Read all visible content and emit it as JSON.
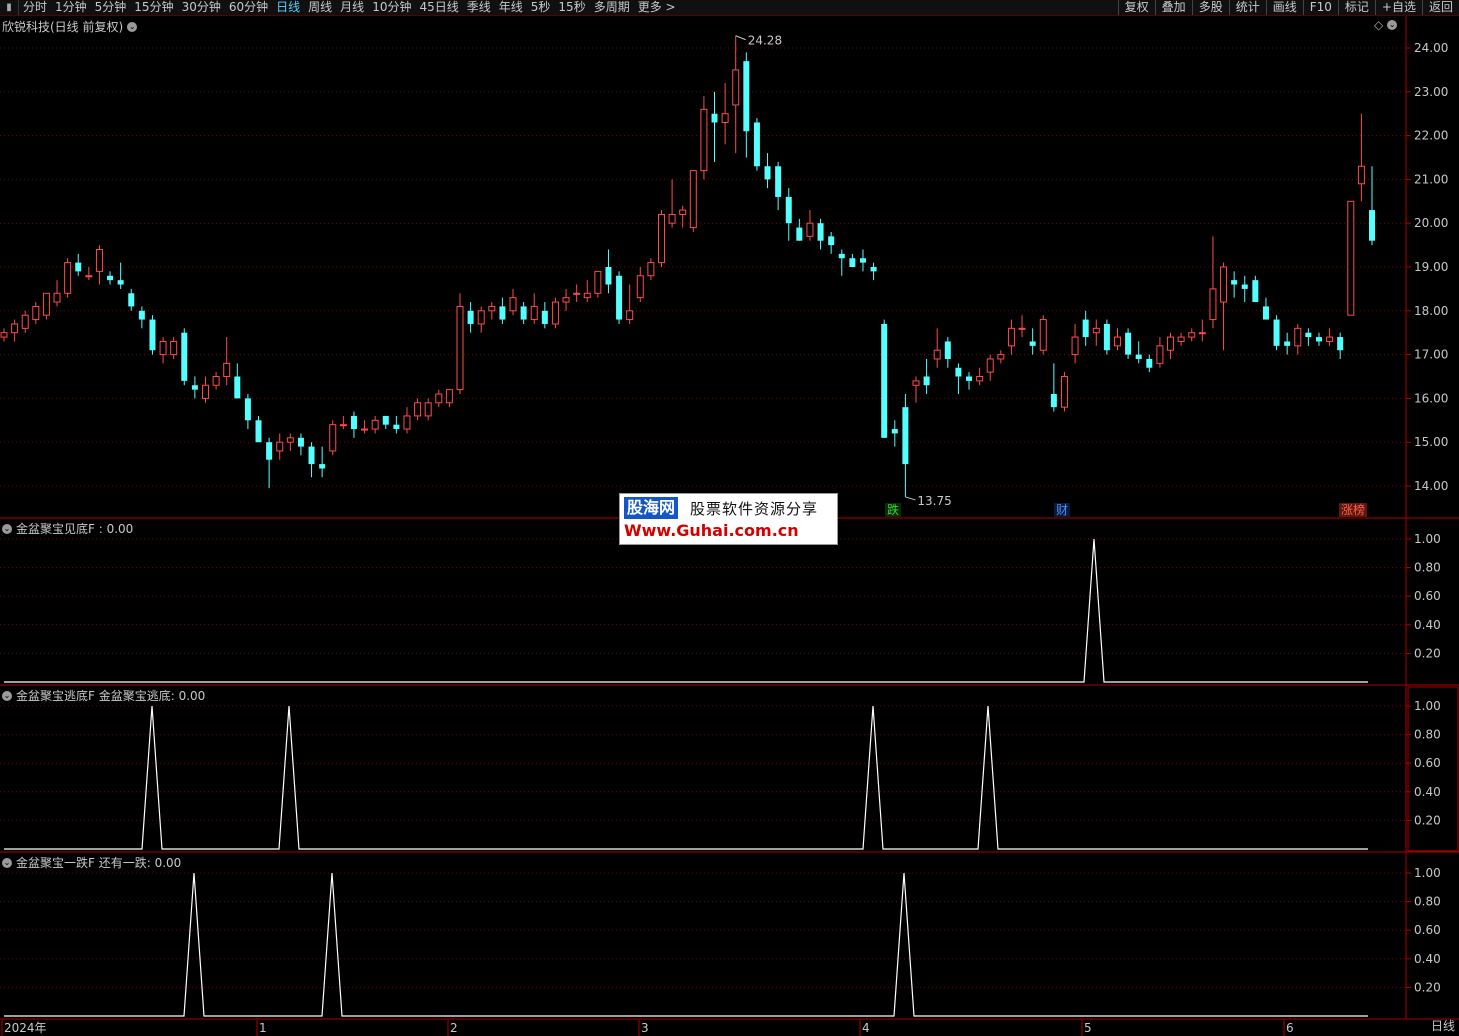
{
  "toolbar": {
    "periods": [
      "分时",
      "1分钟",
      "5分钟",
      "15分钟",
      "30分钟",
      "60分钟",
      "日线",
      "周线",
      "月线",
      "10分钟",
      "45日线",
      "季线",
      "年线",
      "5秒",
      "15秒",
      "多周期",
      "更多 >"
    ],
    "active_period": "日线",
    "right_buttons": [
      "复权",
      "叠加",
      "多股",
      "统计",
      "画线",
      "F10",
      "标记",
      "+自选",
      "返回"
    ]
  },
  "main_panel": {
    "title": "欣锐科技(日线 前复权)",
    "max_label": "24.28",
    "min_label": "13.75",
    "y_ticks": [
      "24.00",
      "23.00",
      "22.00",
      "21.00",
      "20.00",
      "19.00",
      "18.00",
      "17.00",
      "16.00",
      "15.00",
      "14.00"
    ],
    "marks": [
      {
        "text": "跌",
        "color": "#3ad13a"
      },
      {
        "text": "财",
        "color": "#4a90ff"
      },
      {
        "text": "涨榜",
        "color": "#ff5a5a"
      }
    ]
  },
  "ad": {
    "brand": "股海网",
    "slogan": "股票软件资源分享",
    "url": "Www.Guhai.com.cn"
  },
  "panels": [
    {
      "title": "金盆聚宝见底F : 0.00",
      "y_ticks": [
        "1.00",
        "0.80",
        "0.60",
        "0.40",
        "0.20"
      ]
    },
    {
      "title": "金盆聚宝逃底F  金盆聚宝逃底: 0.00",
      "y_ticks": [
        "1.00",
        "0.80",
        "0.60",
        "0.40",
        "0.20"
      ]
    },
    {
      "title": "金盆聚宝一跌F  还有一跌: 0.00",
      "y_ticks": [
        "1.00",
        "0.80",
        "0.60",
        "0.40",
        "0.20"
      ]
    }
  ],
  "x_axis": {
    "labels": [
      "2024年",
      "1",
      "2",
      "3",
      "4",
      "5",
      "6"
    ]
  },
  "bottom_right_label": "日线",
  "colors": {
    "up": "#ff4b4b",
    "down": "#54ffff",
    "grid": "#7a0000",
    "axis": "#b00000",
    "text": "#c8c8c8"
  },
  "chart_data": {
    "type": "candlestick",
    "ylim": [
      13.5,
      24.5
    ],
    "candles": [
      [
        17.4,
        17.6,
        17.3,
        17.5
      ],
      [
        17.5,
        17.8,
        17.3,
        17.7
      ],
      [
        17.6,
        18.0,
        17.5,
        17.9
      ],
      [
        17.8,
        18.2,
        17.7,
        18.1
      ],
      [
        17.9,
        18.4,
        17.8,
        18.4
      ],
      [
        18.2,
        18.7,
        18.1,
        18.4
      ],
      [
        18.4,
        19.2,
        18.3,
        19.1
      ],
      [
        19.1,
        19.3,
        18.8,
        18.9
      ],
      [
        18.8,
        19.0,
        18.7,
        18.8
      ],
      [
        18.9,
        19.5,
        18.6,
        19.4
      ],
      [
        18.8,
        18.9,
        18.6,
        18.7
      ],
      [
        18.7,
        19.1,
        18.5,
        18.6
      ],
      [
        18.4,
        18.5,
        18.0,
        18.1
      ],
      [
        18.0,
        18.1,
        17.6,
        17.8
      ],
      [
        17.8,
        17.9,
        17.0,
        17.1
      ],
      [
        17.0,
        17.4,
        16.8,
        17.3
      ],
      [
        17.0,
        17.4,
        16.9,
        17.3
      ],
      [
        17.5,
        17.6,
        16.3,
        16.4
      ],
      [
        16.3,
        16.5,
        16.0,
        16.2
      ],
      [
        16.0,
        16.5,
        15.9,
        16.3
      ],
      [
        16.3,
        16.6,
        16.2,
        16.5
      ],
      [
        16.5,
        17.4,
        16.3,
        16.8
      ],
      [
        16.5,
        16.8,
        16.0,
        16.0
      ],
      [
        16.0,
        16.1,
        15.3,
        15.5
      ],
      [
        15.5,
        15.6,
        15.1,
        15.0
      ],
      [
        15.0,
        15.1,
        13.95,
        14.6
      ],
      [
        14.8,
        15.2,
        14.6,
        15.0
      ],
      [
        15.0,
        15.2,
        14.8,
        15.1
      ],
      [
        15.1,
        15.2,
        14.7,
        14.9
      ],
      [
        14.9,
        15.0,
        14.2,
        14.5
      ],
      [
        14.5,
        14.9,
        14.2,
        14.4
      ],
      [
        14.8,
        15.5,
        14.7,
        15.4
      ],
      [
        15.4,
        15.6,
        15.3,
        15.4
      ],
      [
        15.6,
        15.7,
        15.1,
        15.3
      ],
      [
        15.3,
        15.5,
        15.2,
        15.3
      ],
      [
        15.3,
        15.6,
        15.2,
        15.5
      ],
      [
        15.6,
        15.6,
        15.3,
        15.4
      ],
      [
        15.4,
        15.6,
        15.2,
        15.3
      ],
      [
        15.3,
        15.8,
        15.2,
        15.6
      ],
      [
        15.6,
        16.0,
        15.5,
        15.9
      ],
      [
        15.6,
        16.0,
        15.5,
        15.9
      ],
      [
        15.9,
        16.2,
        15.8,
        16.1
      ],
      [
        15.9,
        16.2,
        15.8,
        16.2
      ],
      [
        16.2,
        18.4,
        16.1,
        18.1
      ],
      [
        18.0,
        18.2,
        17.5,
        17.7
      ],
      [
        17.7,
        18.1,
        17.5,
        18.0
      ],
      [
        18.0,
        18.2,
        17.8,
        18.1
      ],
      [
        18.1,
        18.3,
        17.7,
        17.8
      ],
      [
        18.0,
        18.5,
        17.9,
        18.3
      ],
      [
        18.1,
        18.2,
        17.7,
        17.8
      ],
      [
        17.8,
        18.4,
        17.7,
        18.1
      ],
      [
        18.0,
        18.2,
        17.6,
        17.7
      ],
      [
        17.7,
        18.3,
        17.6,
        18.2
      ],
      [
        18.2,
        18.5,
        18.0,
        18.3
      ],
      [
        18.4,
        18.6,
        18.2,
        18.4
      ],
      [
        18.3,
        18.7,
        18.2,
        18.4
      ],
      [
        18.4,
        18.9,
        18.3,
        18.9
      ],
      [
        19.0,
        19.4,
        18.4,
        18.6
      ],
      [
        18.8,
        18.9,
        17.7,
        17.8
      ],
      [
        17.8,
        18.6,
        17.7,
        18.0
      ],
      [
        18.3,
        19.0,
        18.2,
        18.8
      ],
      [
        18.8,
        19.2,
        18.7,
        19.1
      ],
      [
        19.1,
        20.3,
        19.0,
        20.2
      ],
      [
        20.0,
        21.0,
        19.9,
        20.2
      ],
      [
        20.2,
        20.4,
        19.9,
        20.3
      ],
      [
        19.9,
        21.2,
        19.8,
        21.2
      ],
      [
        21.2,
        22.9,
        21.0,
        22.6
      ],
      [
        22.5,
        23.0,
        21.4,
        22.3
      ],
      [
        22.3,
        23.2,
        21.8,
        22.5
      ],
      [
        22.7,
        24.28,
        21.6,
        23.5
      ],
      [
        23.7,
        23.9,
        21.5,
        22.1
      ],
      [
        22.3,
        22.4,
        21.2,
        21.3
      ],
      [
        21.3,
        21.6,
        20.8,
        21.0
      ],
      [
        21.3,
        21.4,
        20.3,
        20.6
      ],
      [
        20.6,
        20.8,
        19.6,
        20.0
      ],
      [
        19.9,
        20.1,
        19.6,
        19.6
      ],
      [
        19.7,
        20.3,
        19.6,
        20.0
      ],
      [
        20.0,
        20.1,
        19.4,
        19.6
      ],
      [
        19.7,
        19.8,
        19.3,
        19.5
      ],
      [
        19.3,
        19.4,
        18.8,
        19.2
      ],
      [
        19.2,
        19.3,
        19.0,
        19.0
      ],
      [
        19.2,
        19.4,
        18.9,
        19.1
      ],
      [
        19.0,
        19.1,
        18.7,
        18.9
      ],
      [
        17.7,
        17.8,
        15.1,
        15.1
      ],
      [
        15.3,
        15.5,
        14.9,
        15.2
      ],
      [
        15.8,
        16.1,
        13.75,
        14.5
      ],
      [
        16.3,
        16.5,
        15.9,
        16.4
      ],
      [
        16.5,
        16.9,
        16.1,
        16.3
      ],
      [
        16.9,
        17.6,
        16.7,
        17.1
      ],
      [
        17.3,
        17.4,
        16.7,
        16.9
      ],
      [
        16.7,
        16.8,
        16.1,
        16.5
      ],
      [
        16.5,
        16.6,
        16.2,
        16.4
      ],
      [
        16.4,
        16.7,
        16.3,
        16.5
      ],
      [
        16.6,
        17.0,
        16.4,
        16.9
      ],
      [
        16.9,
        17.1,
        16.8,
        17.0
      ],
      [
        17.2,
        17.8,
        17.0,
        17.6
      ],
      [
        17.6,
        17.9,
        17.4,
        17.6
      ],
      [
        17.3,
        17.6,
        17.0,
        17.2
      ],
      [
        17.1,
        17.9,
        17.0,
        17.8
      ],
      [
        16.1,
        16.8,
        15.7,
        15.8
      ],
      [
        15.8,
        16.6,
        15.7,
        16.5
      ],
      [
        17.0,
        17.7,
        16.8,
        17.4
      ],
      [
        17.8,
        18.0,
        17.2,
        17.4
      ],
      [
        17.5,
        17.8,
        17.2,
        17.6
      ],
      [
        17.7,
        17.8,
        17.0,
        17.1
      ],
      [
        17.2,
        17.6,
        17.1,
        17.4
      ],
      [
        17.5,
        17.6,
        16.9,
        17.0
      ],
      [
        17.0,
        17.3,
        16.8,
        16.9
      ],
      [
        16.9,
        17.0,
        16.6,
        16.7
      ],
      [
        16.8,
        17.4,
        16.7,
        17.2
      ],
      [
        17.1,
        17.5,
        16.9,
        17.4
      ],
      [
        17.3,
        17.5,
        17.2,
        17.4
      ],
      [
        17.4,
        17.6,
        17.3,
        17.5
      ],
      [
        17.5,
        17.8,
        17.3,
        17.5
      ],
      [
        17.8,
        19.7,
        17.6,
        18.5
      ],
      [
        18.2,
        19.1,
        17.1,
        19.0
      ],
      [
        18.7,
        18.9,
        18.3,
        18.6
      ],
      [
        18.6,
        18.8,
        18.2,
        18.5
      ],
      [
        18.7,
        18.8,
        18.3,
        18.2
      ],
      [
        18.1,
        18.3,
        17.8,
        17.8
      ],
      [
        17.8,
        17.9,
        17.1,
        17.2
      ],
      [
        17.3,
        17.5,
        17.0,
        17.2
      ],
      [
        17.2,
        17.7,
        17.0,
        17.6
      ],
      [
        17.5,
        17.6,
        17.2,
        17.4
      ],
      [
        17.4,
        17.5,
        17.2,
        17.3
      ],
      [
        17.3,
        17.6,
        17.2,
        17.4
      ],
      [
        17.4,
        17.5,
        16.9,
        17.1
      ],
      [
        17.9,
        19.6,
        17.9,
        20.5
      ],
      [
        20.9,
        22.5,
        20.5,
        21.3
      ],
      [
        20.3,
        21.3,
        19.5,
        19.6
      ]
    ],
    "signal_panels": [
      {
        "name": "金盆聚宝见底F",
        "peaks": [
          1094
        ]
      },
      {
        "name": "金盆聚宝逃底F",
        "peaks": [
          152,
          289,
          873,
          988
        ]
      },
      {
        "name": "金盆聚宝一跌F",
        "peaks": [
          194,
          332,
          904
        ]
      }
    ]
  }
}
